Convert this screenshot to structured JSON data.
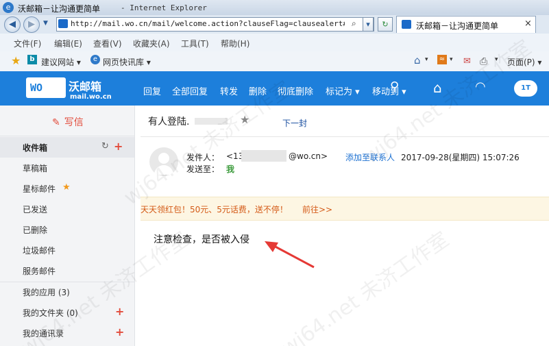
{
  "window": {
    "title": "沃邮箱－让沟通更简单",
    "title_suffix": "- Internet Explorer"
  },
  "address_bar": {
    "url": "http://mail.wo.cn/mail/welcome.action?clauseFlag=clausealert#"
  },
  "tab": {
    "label": "沃邮箱－让沟通更简单",
    "close": "×"
  },
  "menu": {
    "items": [
      "文件(F)",
      "编辑(E)",
      "查看(V)",
      "收藏夹(A)",
      "工具(T)",
      "帮助(H)"
    ]
  },
  "favorites": {
    "suggested_sites": "建议网站",
    "web_slice": "网页快讯库",
    "page_menu": "页面(P)"
  },
  "app": {
    "brand_name": "沃邮箱",
    "domain": "mail.wo.cn",
    "toolbar": {
      "reply": "回复",
      "reply_all": "全部回复",
      "forward": "转发",
      "delete": "删除",
      "delete_permanent": "彻底删除",
      "mark_as": "标记为",
      "move_to": "移动到"
    },
    "cloud_label": "1T",
    "accent_color": "#1d7fdb",
    "compose_color": "#e24b3b"
  },
  "sidebar": {
    "compose": "写信",
    "items": [
      {
        "label": "收件箱"
      },
      {
        "label": "草稿箱"
      },
      {
        "label": "星标邮件"
      },
      {
        "label": "已发送"
      },
      {
        "label": "已删除"
      },
      {
        "label": "垃圾邮件"
      },
      {
        "label": "服务邮件"
      },
      {
        "label": "我的应用 (3)"
      },
      {
        "label": "我的文件夹 (0)"
      },
      {
        "label": "我的通讯录"
      }
    ]
  },
  "mail": {
    "subject": "有人登陆.",
    "next": "下一封",
    "sender_label": "发件人：",
    "sender_prefix": "<13",
    "sender_suffix": "@wo.cn>",
    "add_contact": "添加至联系人",
    "date": "2017-09-28(星期四) 15:07:26",
    "to_label": "发送至：",
    "to_value": "我",
    "promo_text": "天天领红包！50元、5元话费，送不停！",
    "promo_link": "前往>>",
    "body": "注意检查，是否被入侵"
  },
  "watermark": "wj64.net 未济工作室"
}
